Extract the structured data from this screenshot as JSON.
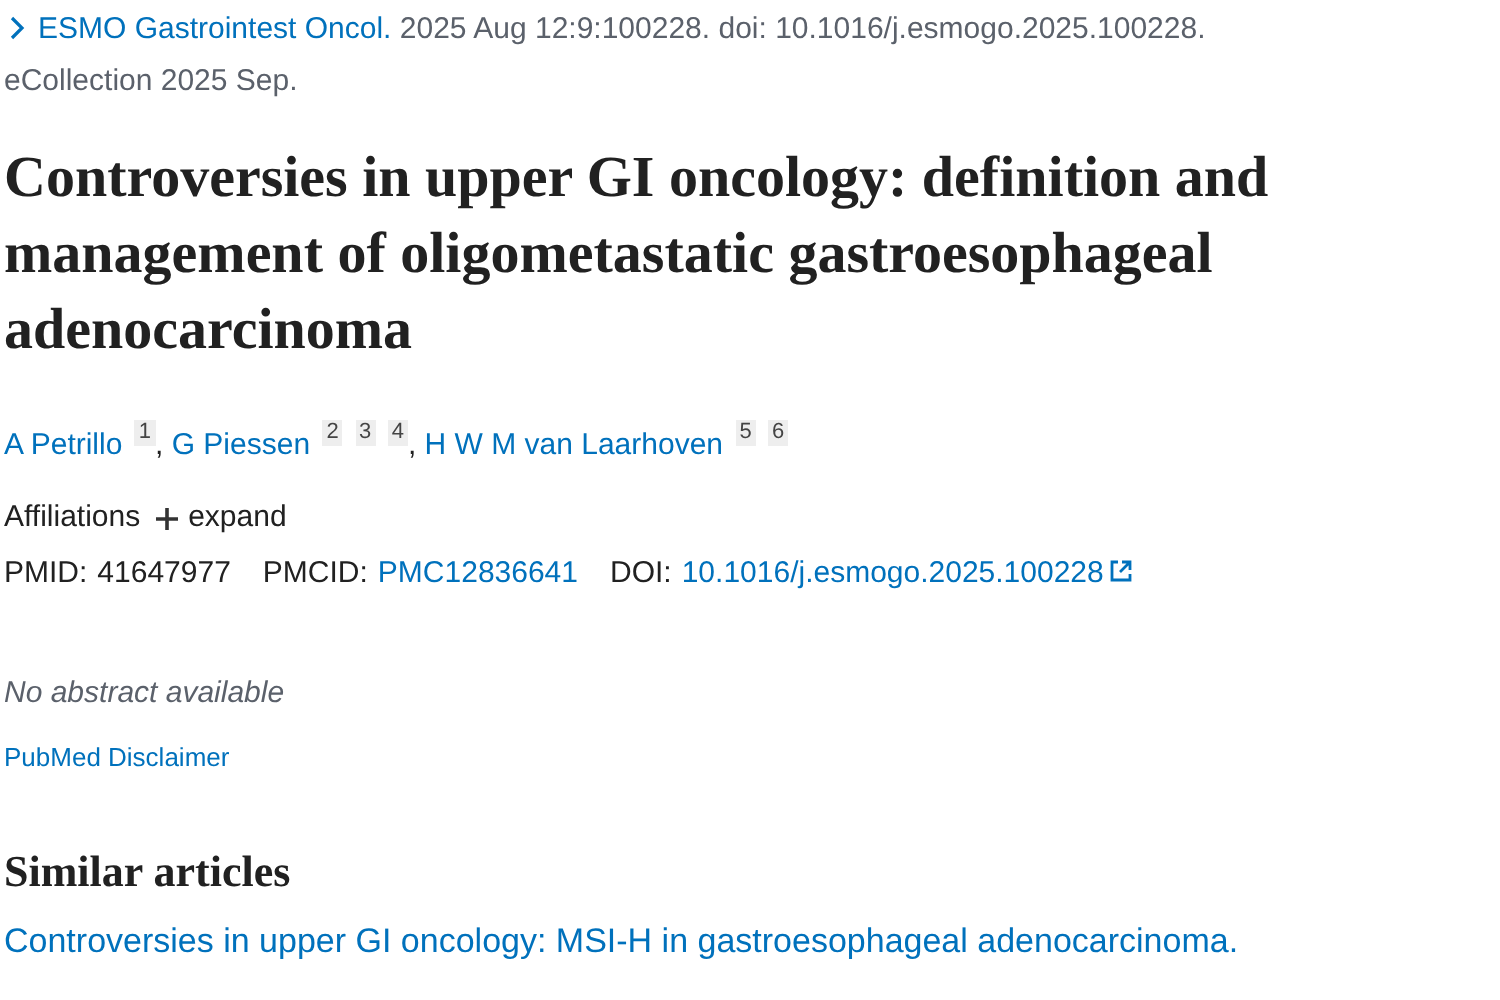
{
  "citation": {
    "journal": "ESMO Gastrointest Oncol.",
    "details": "2025 Aug 12:9:100228. doi: 10.1016/j.esmogo.2025.100228.",
    "collection": "eCollection 2025 Sep."
  },
  "title": "Controversies in upper GI oncology: definition and management of oligometastatic gastroesophageal adenocarcinoma",
  "authors": [
    {
      "name": "A Petrillo",
      "affiliations": [
        "1"
      ]
    },
    {
      "name": "G Piessen",
      "affiliations": [
        "2",
        "3",
        "4"
      ]
    },
    {
      "name": "H W M van Laarhoven",
      "affiliations": [
        "5",
        "6"
      ]
    }
  ],
  "author_separator": ",",
  "affiliations": {
    "label": "Affiliations",
    "toggle": "expand"
  },
  "identifiers": [
    {
      "label": "PMID:",
      "value": "41647977",
      "kind": "text"
    },
    {
      "label": "PMCID:",
      "value": "PMC12836641",
      "kind": "link"
    },
    {
      "label": "DOI:",
      "value": "10.1016/j.esmogo.2025.100228",
      "kind": "external"
    }
  ],
  "abstract_note": "No abstract available",
  "disclaimer": "PubMed Disclaimer",
  "similar_articles": {
    "heading": "Similar articles",
    "items": [
      "Controversies in upper GI oncology: MSI-H in gastroesophageal adenocarcinoma."
    ]
  }
}
